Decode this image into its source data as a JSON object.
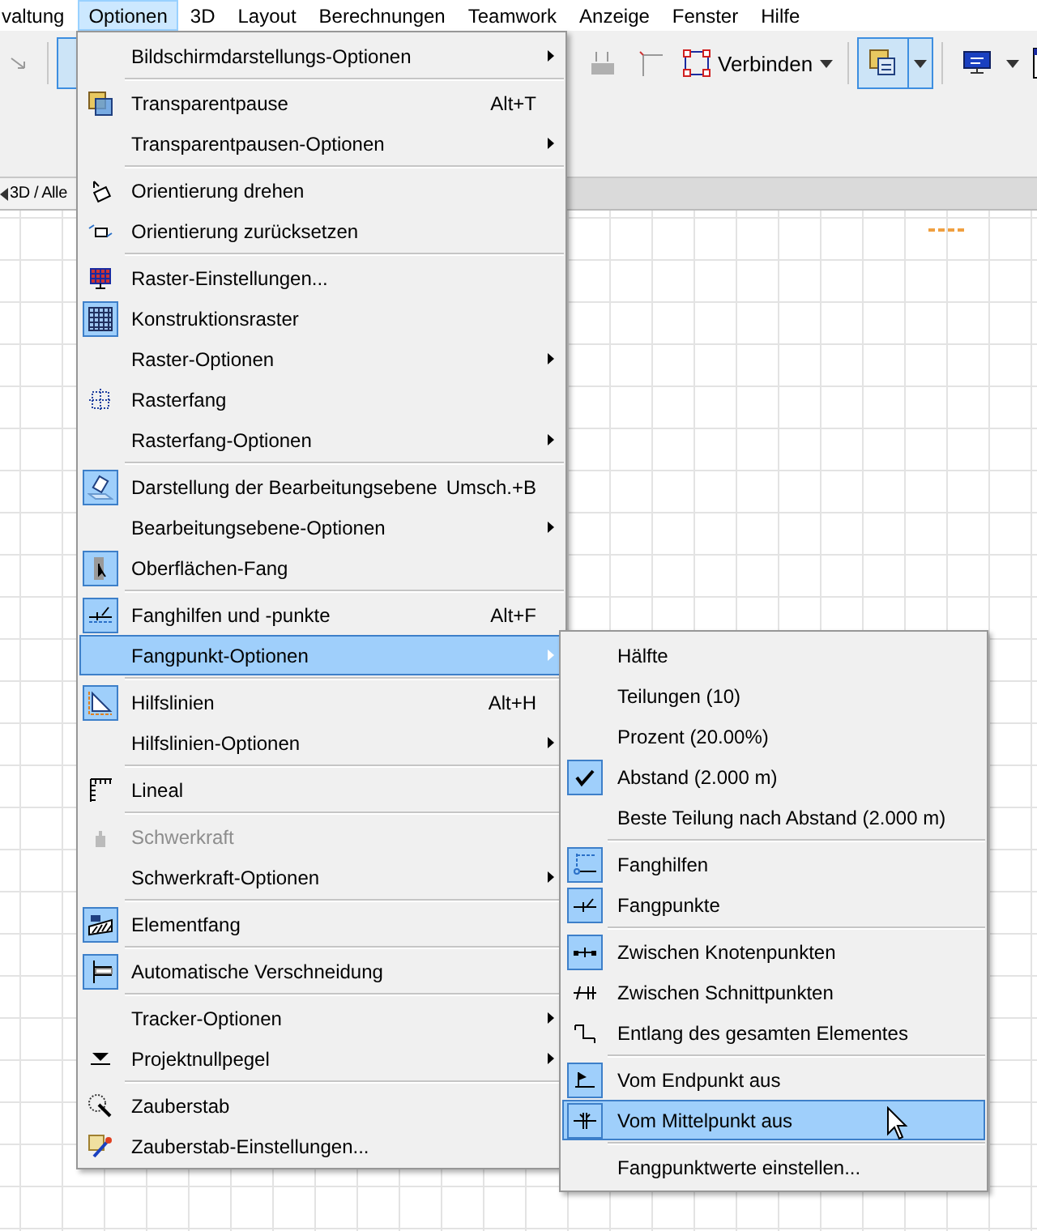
{
  "menubar": [
    {
      "label": "valtung",
      "selected": false
    },
    {
      "label": "Optionen",
      "selected": true
    },
    {
      "label": "3D",
      "selected": false
    },
    {
      "label": "Layout",
      "selected": false
    },
    {
      "label": "Berechnungen",
      "selected": false
    },
    {
      "label": "Teamwork",
      "selected": false
    },
    {
      "label": "Anzeige",
      "selected": false
    },
    {
      "label": "Fenster",
      "selected": false
    },
    {
      "label": "Hilfe",
      "selected": false
    }
  ],
  "toolbar": {
    "connect_button": "Verbinden"
  },
  "view_tab": {
    "label": "3D / Alle"
  },
  "options_menu": [
    {
      "kind": "item",
      "label": "Bildschirmdarstellungs-Optionen",
      "submenu": true,
      "checked": false,
      "selected": false,
      "disabled": false
    },
    {
      "kind": "separator"
    },
    {
      "kind": "item",
      "label": "Transparentpause",
      "shortcut": "Alt+T",
      "submenu": false,
      "checked": false,
      "selected": false,
      "disabled": false
    },
    {
      "kind": "item",
      "label": "Transparentpausen-Optionen",
      "submenu": true,
      "checked": false,
      "selected": false,
      "disabled": false
    },
    {
      "kind": "separator"
    },
    {
      "kind": "item",
      "label": "Orientierung drehen",
      "submenu": false,
      "checked": false,
      "selected": false,
      "disabled": false
    },
    {
      "kind": "item",
      "label": "Orientierung zurücksetzen",
      "submenu": false,
      "checked": false,
      "selected": false,
      "disabled": false
    },
    {
      "kind": "separator"
    },
    {
      "kind": "item",
      "label": "Raster-Einstellungen...",
      "submenu": false,
      "checked": false,
      "selected": false,
      "disabled": false
    },
    {
      "kind": "item",
      "label": "Konstruktionsraster",
      "submenu": false,
      "checked": true,
      "selected": false,
      "disabled": false
    },
    {
      "kind": "item",
      "label": "Raster-Optionen",
      "submenu": true,
      "checked": false,
      "selected": false,
      "disabled": false
    },
    {
      "kind": "item",
      "label": "Rasterfang",
      "submenu": false,
      "checked": false,
      "selected": false,
      "disabled": false
    },
    {
      "kind": "item",
      "label": "Rasterfang-Optionen",
      "submenu": true,
      "checked": false,
      "selected": false,
      "disabled": false
    },
    {
      "kind": "separator"
    },
    {
      "kind": "item",
      "label": "Darstellung der Bearbeitungsebene",
      "shortcut": "Umsch.+B",
      "submenu": false,
      "checked": true,
      "selected": false,
      "disabled": false
    },
    {
      "kind": "item",
      "label": "Bearbeitungsebene-Optionen",
      "submenu": true,
      "checked": false,
      "selected": false,
      "disabled": false
    },
    {
      "kind": "item",
      "label": "Oberflächen-Fang",
      "submenu": false,
      "checked": true,
      "selected": false,
      "disabled": false
    },
    {
      "kind": "separator"
    },
    {
      "kind": "item",
      "label": "Fanghilfen und -punkte",
      "shortcut": "Alt+F",
      "submenu": false,
      "checked": true,
      "selected": false,
      "disabled": false
    },
    {
      "kind": "item",
      "label": "Fangpunkt-Optionen",
      "submenu": true,
      "checked": false,
      "selected": true,
      "disabled": false
    },
    {
      "kind": "separator"
    },
    {
      "kind": "item",
      "label": "Hilfslinien",
      "shortcut": "Alt+H",
      "submenu": false,
      "checked": true,
      "selected": false,
      "disabled": false
    },
    {
      "kind": "item",
      "label": "Hilfslinien-Optionen",
      "submenu": true,
      "checked": false,
      "selected": false,
      "disabled": false
    },
    {
      "kind": "separator"
    },
    {
      "kind": "item",
      "label": "Lineal",
      "submenu": false,
      "checked": false,
      "selected": false,
      "disabled": false
    },
    {
      "kind": "separator"
    },
    {
      "kind": "item",
      "label": "Schwerkraft",
      "submenu": false,
      "checked": false,
      "selected": false,
      "disabled": true
    },
    {
      "kind": "item",
      "label": "Schwerkraft-Optionen",
      "submenu": true,
      "checked": false,
      "selected": false,
      "disabled": false
    },
    {
      "kind": "separator"
    },
    {
      "kind": "item",
      "label": "Elementfang",
      "submenu": false,
      "checked": true,
      "selected": false,
      "disabled": false
    },
    {
      "kind": "separator"
    },
    {
      "kind": "item",
      "label": "Automatische Verschneidung",
      "submenu": false,
      "checked": true,
      "selected": false,
      "disabled": false
    },
    {
      "kind": "separator"
    },
    {
      "kind": "item",
      "label": "Tracker-Optionen",
      "submenu": true,
      "checked": false,
      "selected": false,
      "disabled": false
    },
    {
      "kind": "item",
      "label": "Projektnullpegel",
      "submenu": true,
      "checked": false,
      "selected": false,
      "disabled": false
    },
    {
      "kind": "separator"
    },
    {
      "kind": "item",
      "label": "Zauberstab",
      "submenu": false,
      "checked": false,
      "selected": false,
      "disabled": false
    },
    {
      "kind": "item",
      "label": "Zauberstab-Einstellungen...",
      "submenu": false,
      "checked": false,
      "selected": false,
      "disabled": false
    }
  ],
  "snap_submenu": [
    {
      "kind": "item",
      "label": "Hälfte",
      "checked": false,
      "selected": false
    },
    {
      "kind": "item",
      "label": "Teilungen (10)",
      "checked": false,
      "selected": false
    },
    {
      "kind": "item",
      "label": "Prozent (20.00%)",
      "checked": false,
      "selected": false
    },
    {
      "kind": "item",
      "label": "Abstand (2.000 m)",
      "checked": true,
      "selected": false
    },
    {
      "kind": "item",
      "label": "Beste Teilung nach Abstand (2.000 m)",
      "checked": false,
      "selected": false
    },
    {
      "kind": "separator"
    },
    {
      "kind": "item",
      "label": "Fanghilfen",
      "checked": true,
      "selected": false
    },
    {
      "kind": "item",
      "label": "Fangpunkte",
      "checked": true,
      "selected": false
    },
    {
      "kind": "separator"
    },
    {
      "kind": "item",
      "label": "Zwischen Knotenpunkten",
      "checked": true,
      "selected": false
    },
    {
      "kind": "item",
      "label": "Zwischen Schnittpunkten",
      "checked": false,
      "selected": false
    },
    {
      "kind": "item",
      "label": "Entlang des gesamten Elementes",
      "checked": false,
      "selected": false
    },
    {
      "kind": "separator"
    },
    {
      "kind": "item",
      "label": "Vom Endpunkt aus",
      "checked": true,
      "selected": false
    },
    {
      "kind": "item",
      "label": "Vom Mittelpunkt aus",
      "checked": true,
      "selected": true
    },
    {
      "kind": "separator"
    },
    {
      "kind": "item",
      "label": "Fangpunktwerte einstellen...",
      "checked": false,
      "selected": false
    }
  ]
}
